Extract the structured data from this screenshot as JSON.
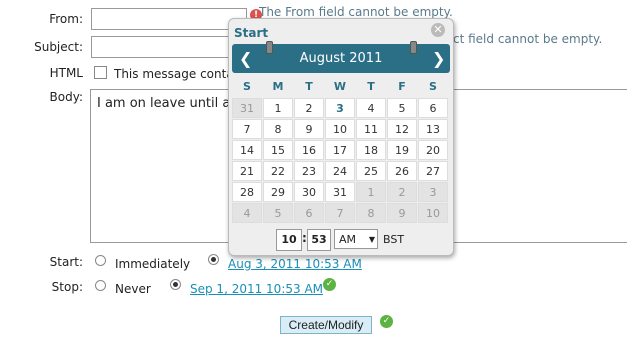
{
  "form": {
    "from_label": "From:",
    "from_value": "",
    "from_error": "The From field cannot be empty.",
    "subject_label": "Subject:",
    "subject_value": "",
    "subject_error": "ct field cannot be empty.",
    "html_label": "HTML",
    "html_checkbox_label": "This message conta",
    "body_label": "Body:",
    "body_text": "I am on leave until a",
    "start_label": "Start:",
    "start_immediately": "Immediately",
    "start_date": "Aug 3, 2011 10:53 AM",
    "stop_label": "Stop:",
    "stop_never": "Never",
    "stop_date": "Sep 1, 2011 10:53 AM",
    "submit_label": "Create/Modify"
  },
  "calendar": {
    "title": "Start",
    "month_label": "August 2011",
    "weekdays": [
      "S",
      "M",
      "T",
      "W",
      "T",
      "F",
      "S"
    ],
    "weeks": [
      [
        {
          "d": "31",
          "o": true
        },
        {
          "d": "1"
        },
        {
          "d": "2"
        },
        {
          "d": "3",
          "t": true
        },
        {
          "d": "4"
        },
        {
          "d": "5"
        },
        {
          "d": "6"
        }
      ],
      [
        {
          "d": "7"
        },
        {
          "d": "8"
        },
        {
          "d": "9"
        },
        {
          "d": "10"
        },
        {
          "d": "11"
        },
        {
          "d": "12"
        },
        {
          "d": "13"
        }
      ],
      [
        {
          "d": "14"
        },
        {
          "d": "15"
        },
        {
          "d": "16"
        },
        {
          "d": "17"
        },
        {
          "d": "18"
        },
        {
          "d": "19"
        },
        {
          "d": "20"
        }
      ],
      [
        {
          "d": "21"
        },
        {
          "d": "22"
        },
        {
          "d": "23"
        },
        {
          "d": "24"
        },
        {
          "d": "25"
        },
        {
          "d": "26"
        },
        {
          "d": "27"
        }
      ],
      [
        {
          "d": "28"
        },
        {
          "d": "29"
        },
        {
          "d": "30"
        },
        {
          "d": "31"
        },
        {
          "d": "1",
          "o": true
        },
        {
          "d": "2",
          "o": true
        },
        {
          "d": "3",
          "o": true
        }
      ],
      [
        {
          "d": "4",
          "o": true
        },
        {
          "d": "5",
          "o": true
        },
        {
          "d": "6",
          "o": true
        },
        {
          "d": "7",
          "o": true
        },
        {
          "d": "8",
          "o": true
        },
        {
          "d": "9",
          "o": true
        },
        {
          "d": "10",
          "o": true
        }
      ]
    ],
    "hour": "10",
    "time_sep": ":",
    "minute": "53",
    "ampm": "AM",
    "timezone": "BST"
  }
}
